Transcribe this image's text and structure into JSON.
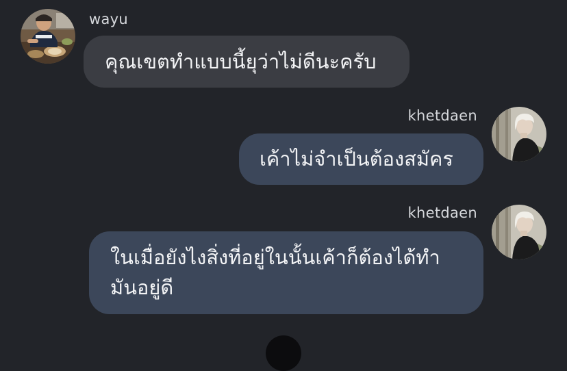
{
  "chat": {
    "messages": [
      {
        "sender": "wayu",
        "direction": "incoming",
        "text": "คุณเขตทำแบบนี้ยุว่าไม่ดีนะครับ"
      },
      {
        "sender": "khetdaen",
        "direction": "outgoing",
        "text": "เค้าไม่จำเป็นต้องสมัคร"
      },
      {
        "sender": "khetdaen",
        "direction": "outgoing",
        "text": "ในเมื่อยังไงสิ่งที่อยู่ในนั้นเค้าก็ต้องได้ทำ\nมันอยู่ดี"
      }
    ]
  },
  "colors": {
    "background": "#222429",
    "incoming_bubble": "#3b3d43",
    "outgoing_bubble": "#3c475a",
    "text": "#f2f3f5",
    "username": "#d6d8dc"
  }
}
